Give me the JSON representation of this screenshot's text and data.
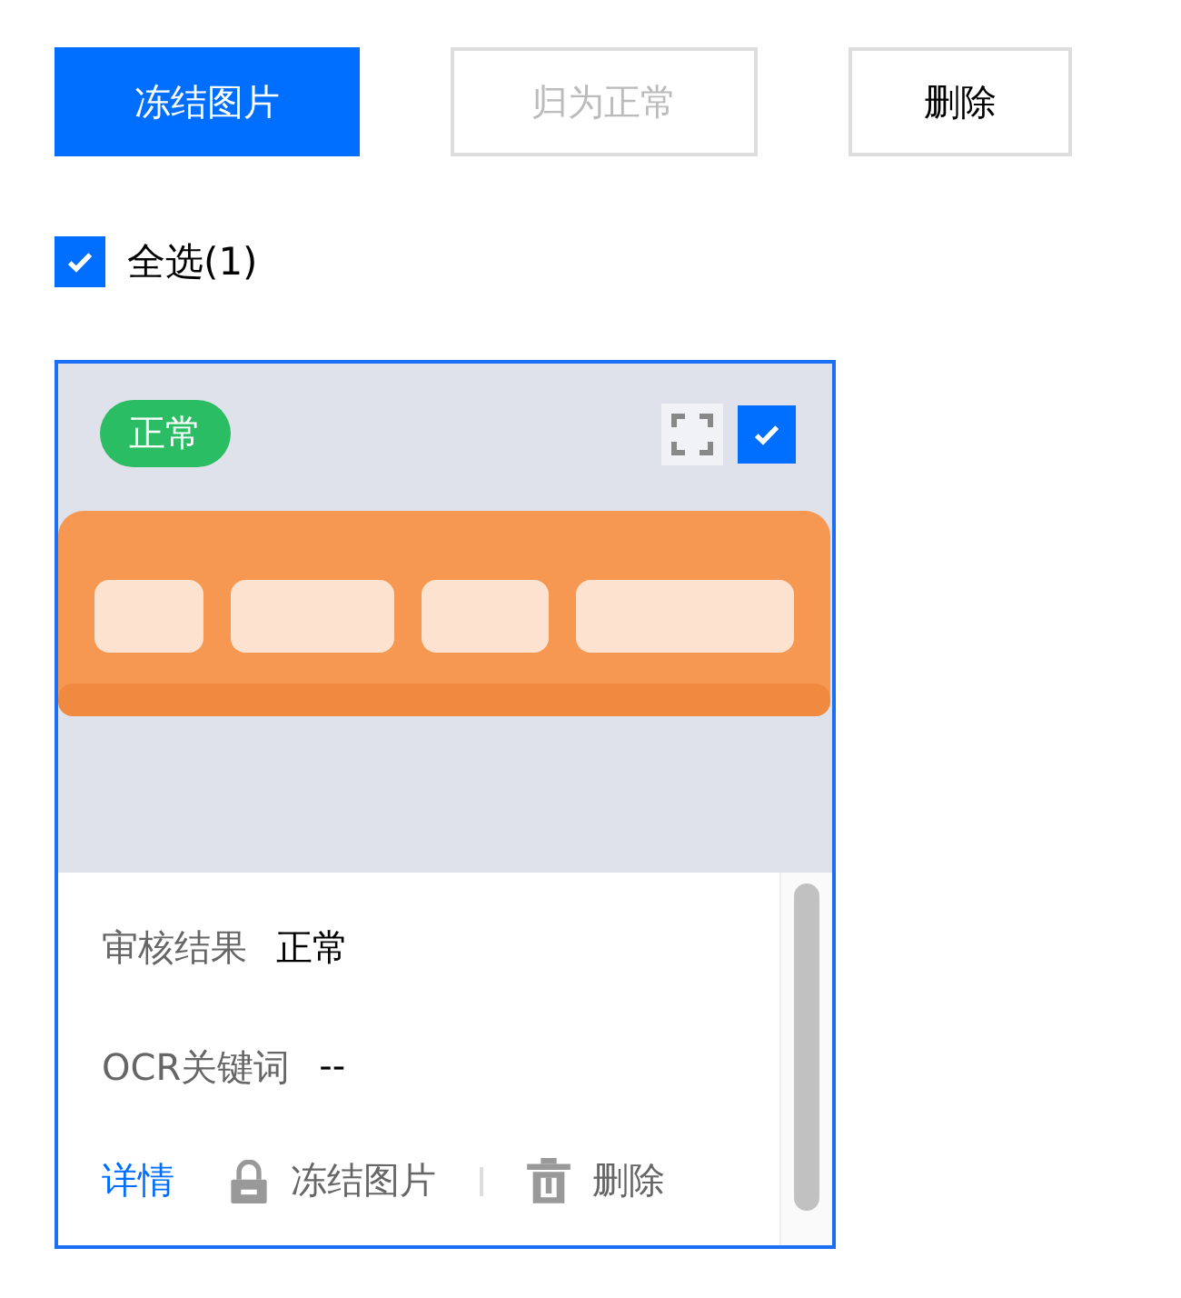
{
  "buttons": [
    {
      "label": "冻结图片",
      "kind": "primary",
      "disabled": false
    },
    {
      "label": "归为正常",
      "kind": "default",
      "disabled": true
    },
    {
      "label": "删除",
      "kind": "default",
      "disabled": false
    }
  ],
  "select_all": {
    "label": "全选(1)",
    "checked": true
  },
  "cards": [
    {
      "status": "正常",
      "color": "#2bbd63",
      "selected": true,
      "image": {
        "kind": "picture"
      },
      "fields": [
        {
          "label": "审核结果",
          "value": "正常"
        },
        {
          "label": "OCR关键词",
          "value": "--"
        }
      ],
      "actions": [
        {
          "label": "详情",
          "kind": "link"
        },
        {
          "label": "冻结图片",
          "kind": "lock"
        },
        {
          "label": "删除",
          "kind": "trash"
        }
      ]
    }
  ]
}
